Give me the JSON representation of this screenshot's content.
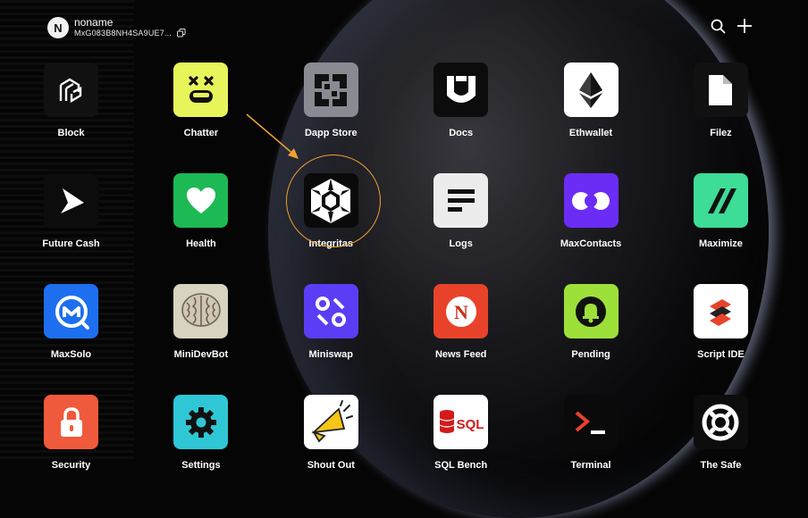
{
  "user": {
    "avatar_initial": "N",
    "name": "noname",
    "address": "MxG083B8NH4SA9UE7..."
  },
  "icons": {
    "copy": "copy-icon",
    "search": "search-icon",
    "add": "plus-icon"
  },
  "annotation": {
    "highlight_color": "#f0a030",
    "target": "Integritas"
  },
  "apps": [
    {
      "label": "Block",
      "icon": "block-icon",
      "bg": "#111111"
    },
    {
      "label": "Chatter",
      "icon": "chatter-face-icon",
      "bg": "#e8f55a"
    },
    {
      "label": "Dapp Store",
      "icon": "dapp-store-icon",
      "bg": "#8a8a92"
    },
    {
      "label": "Docs",
      "icon": "docs-icon",
      "bg": "#0c0c0c"
    },
    {
      "label": "Ethwallet",
      "icon": "ethereum-icon",
      "bg": "#ffffff"
    },
    {
      "label": "Filez",
      "icon": "file-icon",
      "bg": "#111111"
    },
    {
      "label": "Future Cash",
      "icon": "future-cash-icon",
      "bg": "#0c0c0c"
    },
    {
      "label": "Health",
      "icon": "heart-icon",
      "bg": "#1db954"
    },
    {
      "label": "Integritas",
      "icon": "integritas-icon",
      "bg": "#0a0a0a"
    },
    {
      "label": "Logs",
      "icon": "logs-icon",
      "bg": "#ececec"
    },
    {
      "label": "MaxContacts",
      "icon": "max-contacts-icon",
      "bg": "#6b2cf5"
    },
    {
      "label": "Maximize",
      "icon": "maximize-icon",
      "bg": "#3ddc97"
    },
    {
      "label": "MaxSolo",
      "icon": "max-solo-icon",
      "bg": "#1e6ff0"
    },
    {
      "label": "MiniDevBot",
      "icon": "brain-icon",
      "bg": "#d8d2c0"
    },
    {
      "label": "Miniswap",
      "icon": "miniswap-icon",
      "bg": "#5b3df5"
    },
    {
      "label": "News Feed",
      "icon": "news-feed-icon",
      "bg": "#e8432a"
    },
    {
      "label": "Pending",
      "icon": "bell-icon",
      "bg": "#9ee03a"
    },
    {
      "label": "Script IDE",
      "icon": "script-ide-icon",
      "bg": "#ffffff"
    },
    {
      "label": "Security",
      "icon": "lock-icon",
      "bg": "#f05a3c"
    },
    {
      "label": "Settings",
      "icon": "gear-icon",
      "bg": "#2fc7d6"
    },
    {
      "label": "Shout Out",
      "icon": "megaphone-icon",
      "bg": "#ffffff"
    },
    {
      "label": "SQL Bench",
      "icon": "sql-bench-icon",
      "bg": "#ffffff"
    },
    {
      "label": "Terminal",
      "icon": "terminal-icon",
      "bg": "#0a0a0a"
    },
    {
      "label": "The Safe",
      "icon": "safe-icon",
      "bg": "#0c0c0c"
    }
  ]
}
